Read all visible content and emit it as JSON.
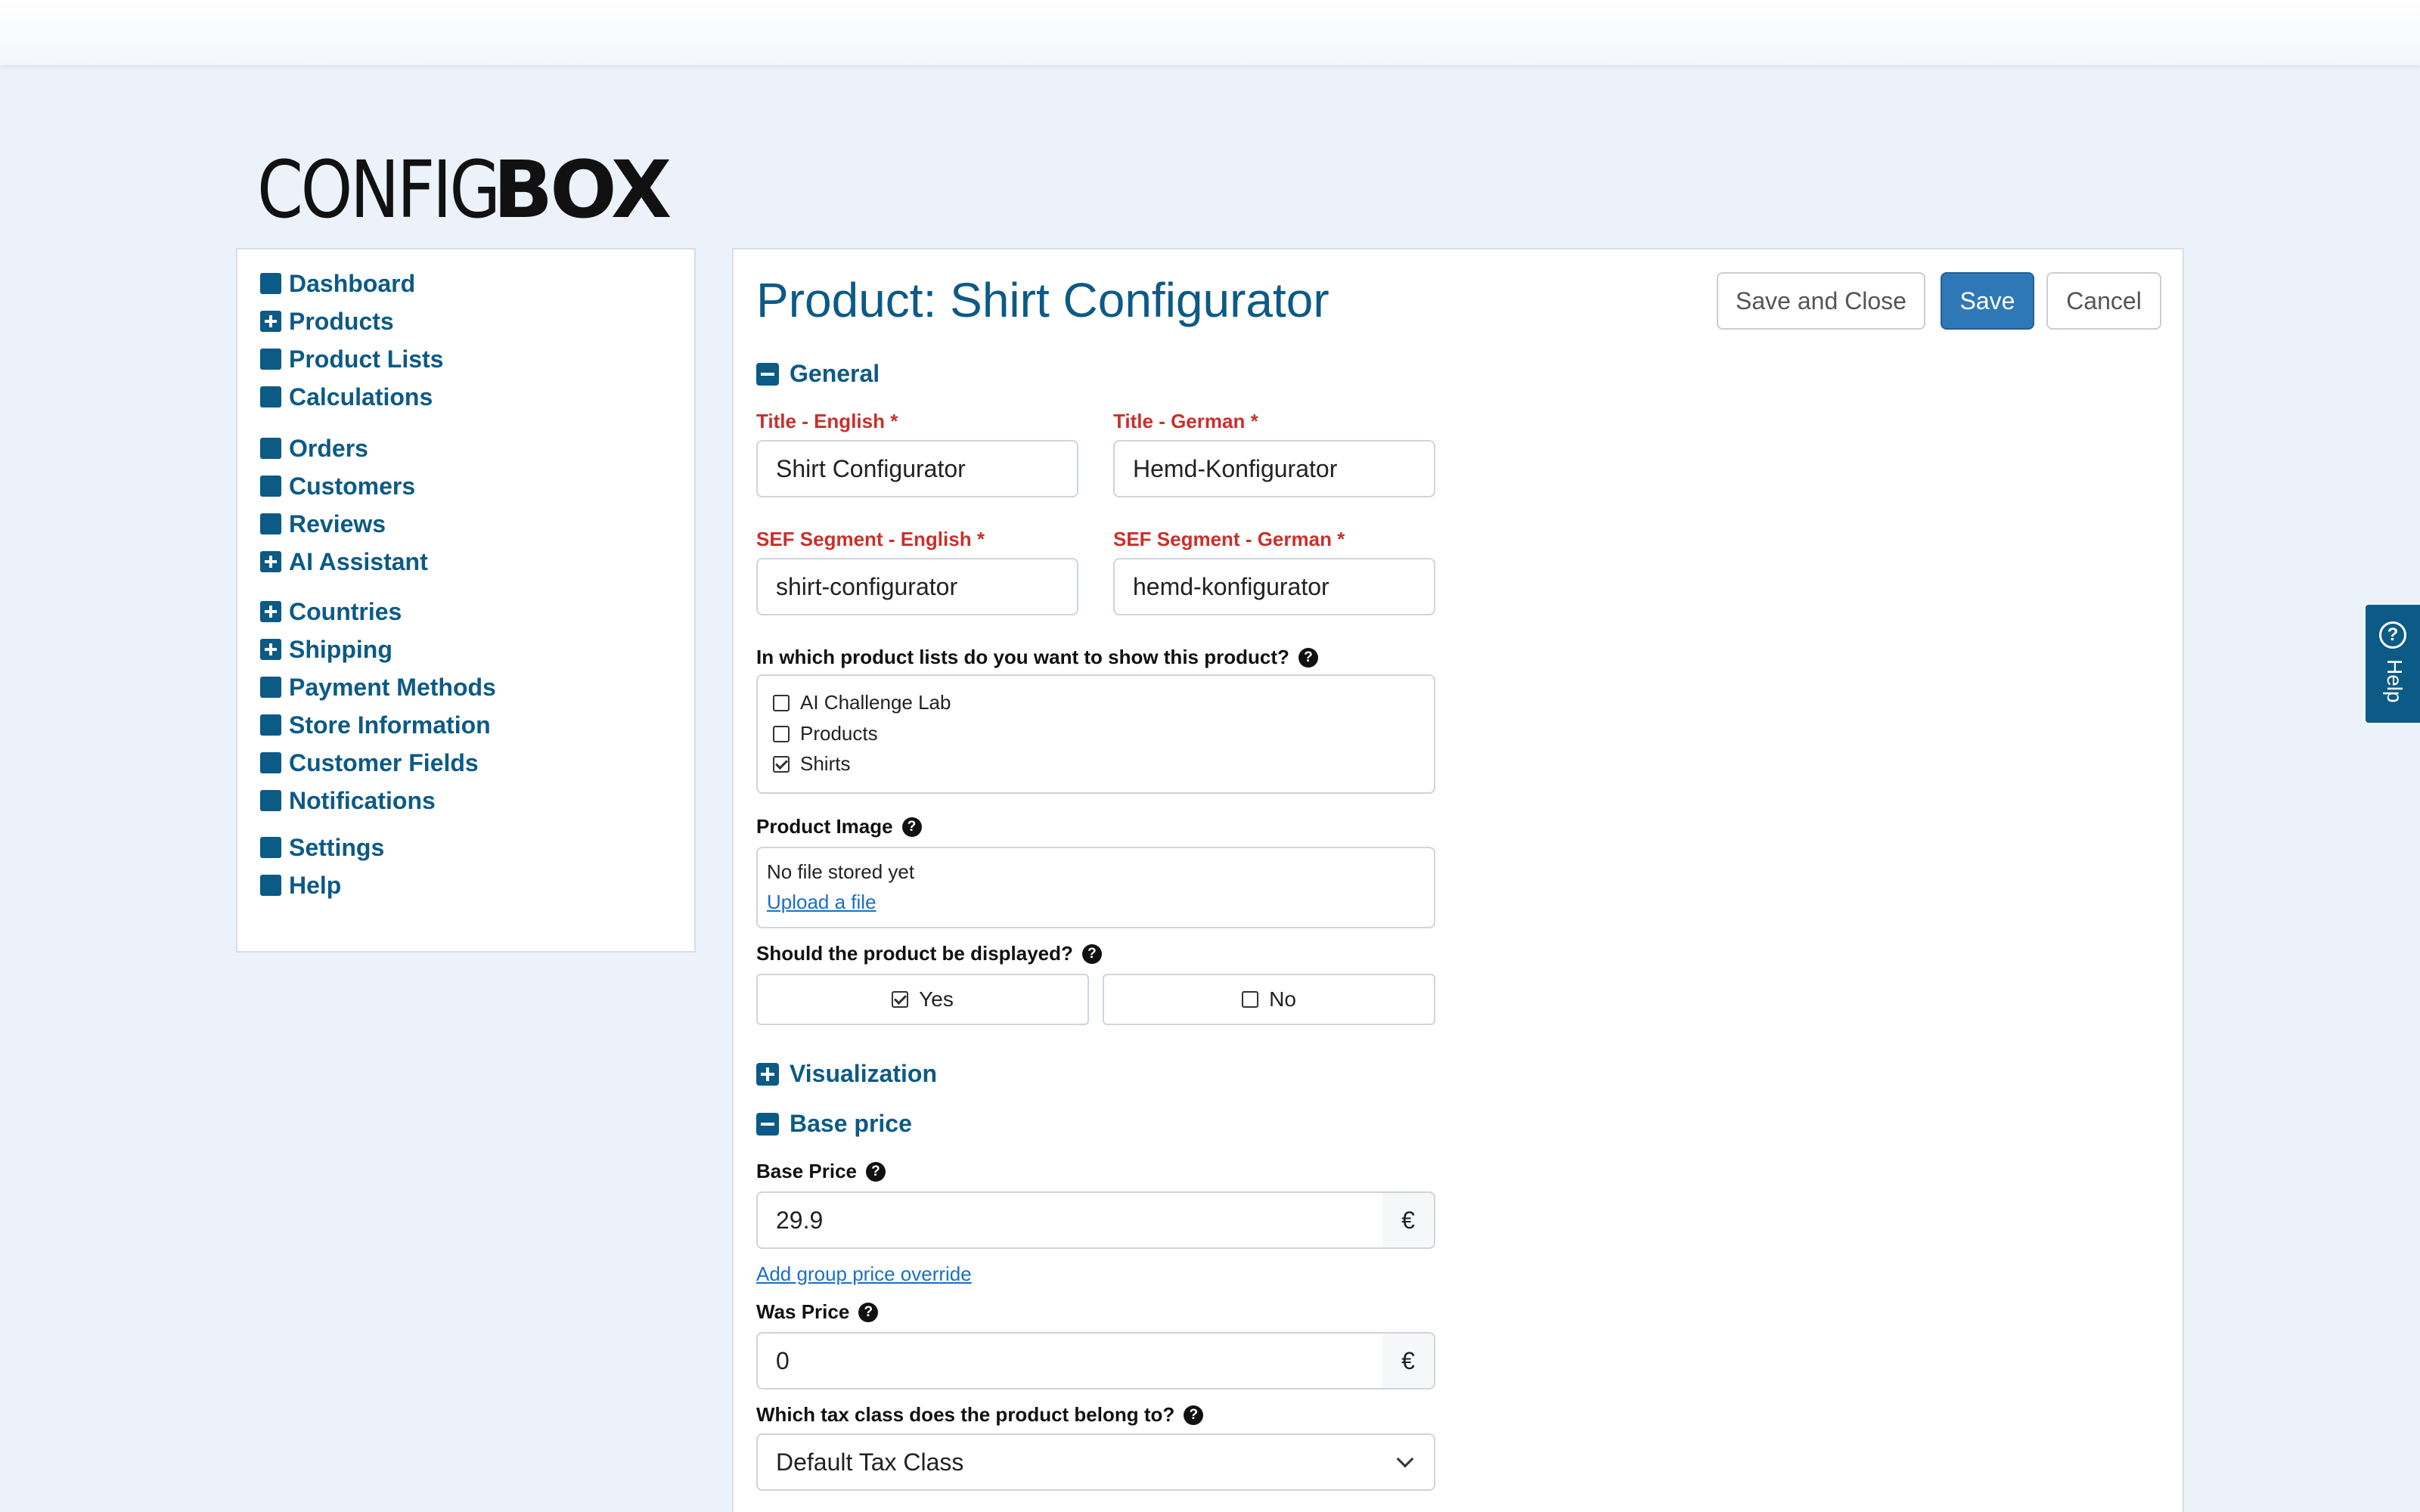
{
  "logo": {
    "light": "CONFIG",
    "bold": "BOX"
  },
  "sidebar": {
    "items": [
      {
        "label": "Dashboard",
        "icon": "square-icon"
      },
      {
        "label": "Products",
        "icon": "plus-square-icon"
      },
      {
        "label": "Product Lists",
        "icon": "square-icon"
      },
      {
        "label": "Calculations",
        "icon": "square-icon"
      },
      {
        "label": "Orders",
        "icon": "square-icon"
      },
      {
        "label": "Customers",
        "icon": "square-icon"
      },
      {
        "label": "Reviews",
        "icon": "square-icon"
      },
      {
        "label": "AI Assistant",
        "icon": "plus-square-icon"
      },
      {
        "label": "Countries",
        "icon": "plus-square-icon"
      },
      {
        "label": "Shipping",
        "icon": "plus-square-icon"
      },
      {
        "label": "Payment Methods",
        "icon": "square-icon"
      },
      {
        "label": "Store Information",
        "icon": "square-icon"
      },
      {
        "label": "Customer Fields",
        "icon": "square-icon"
      },
      {
        "label": "Notifications",
        "icon": "square-icon"
      },
      {
        "label": "Settings",
        "icon": "square-icon"
      },
      {
        "label": "Help",
        "icon": "square-icon"
      }
    ]
  },
  "main": {
    "title": "Product: Shirt Configurator",
    "buttons": {
      "save_close": "Save and Close",
      "save": "Save",
      "cancel": "Cancel"
    },
    "sections": {
      "general": "General",
      "visualization": "Visualization",
      "base_price": "Base price"
    },
    "general": {
      "title_en_label": "Title - English *",
      "title_en_value": "Shirt Configurator",
      "title_de_label": "Title - German *",
      "title_de_value": "Hemd-Konfigurator",
      "sef_en_label": "SEF Segment - English *",
      "sef_en_value": "shirt-configurator",
      "sef_de_label": "SEF Segment - German *",
      "sef_de_value": "hemd-konfigurator",
      "lists_label": "In which product lists do you want to show this product?",
      "lists": [
        {
          "label": "AI Challenge Lab",
          "checked": false
        },
        {
          "label": "Products",
          "checked": false
        },
        {
          "label": "Shirts",
          "checked": true
        }
      ],
      "image_label": "Product Image",
      "image_status": "No file stored yet",
      "image_upload": "Upload a file",
      "display_label": "Should the product be displayed?",
      "display_yes": "Yes",
      "display_no": "No",
      "display_value": "Yes"
    },
    "pricing": {
      "base_price_label": "Base Price",
      "base_price_value": "29.9",
      "currency": "€",
      "group_override": "Add group price override",
      "was_price_label": "Was Price",
      "was_price_value": "0",
      "tax_label": "Which tax class does the product belong to?",
      "tax_value": "Default Tax Class"
    }
  },
  "help_tab": {
    "label": "Help"
  },
  "colors": {
    "accent": "#0c5a86",
    "primary_button": "#2f78b7",
    "required": "#c9302c",
    "background": "#ecf2f9"
  }
}
